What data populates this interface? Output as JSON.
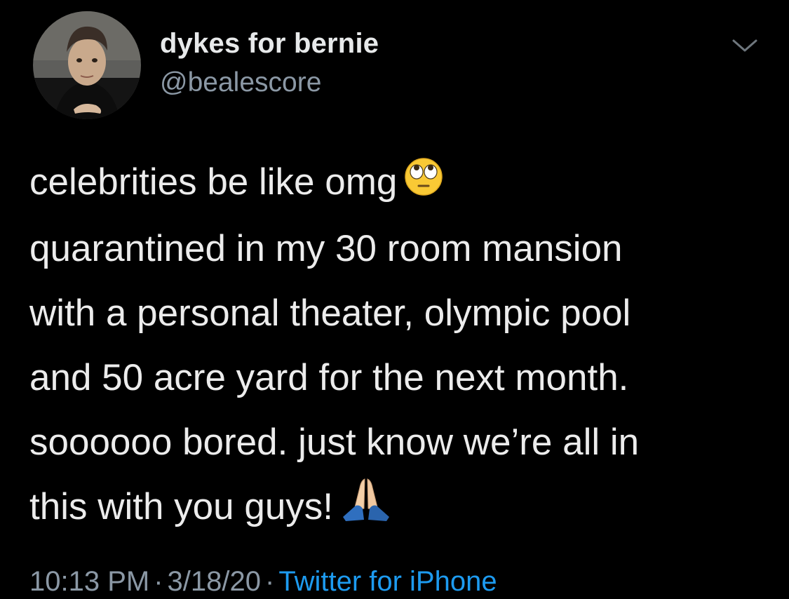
{
  "tweet": {
    "display_name": "dykes for bernie",
    "handle": "@bealescore",
    "lines": [
      "celebrities be like omg",
      "quarantined in my 30 room mansion",
      "with a personal theater, olympic pool",
      "and 50 acre yard for the next month.",
      "soooooo bored. just know we’re all in",
      "this with you guys!"
    ],
    "emoji_1": "face-with-rolling-eyes",
    "emoji_2": "folded-hands-light-skin-tone",
    "time": "10:13 PM",
    "separator": "·",
    "date": "3/18/20",
    "source": "Twitter for iPhone"
  },
  "colors": {
    "background": "#000000",
    "primary_text": "#e7e9ea",
    "secondary_text": "#8b98a5",
    "link": "#1d9bf0"
  }
}
